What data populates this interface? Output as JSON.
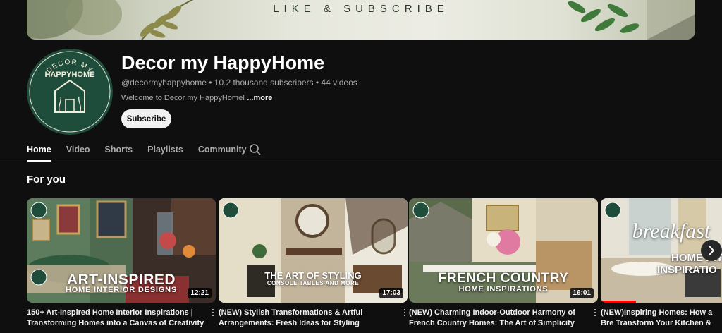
{
  "banner": {
    "text": "LIKE & SUBSCRIBE"
  },
  "channel": {
    "name": "Decor my HappyHome",
    "meta": "@decormyhappyhome • 10.2 thousand subscribers • 44 videos",
    "description": "Welcome to Decor my HappyHome!",
    "more_label": "...more",
    "subscribe_label": "Subscribe",
    "avatar_text_top": "DECOR MY",
    "avatar_text_mid": "HAPPYHOME",
    "accent_color": "#1f4d3c"
  },
  "tabs": [
    {
      "label": "Home",
      "active": true
    },
    {
      "label": "Video",
      "active": false
    },
    {
      "label": "Shorts",
      "active": false
    },
    {
      "label": "Playlists",
      "active": false
    },
    {
      "label": "Community",
      "active": false
    }
  ],
  "section": {
    "title": "For you"
  },
  "videos": [
    {
      "overlay_line1": "ART-INSPIRED",
      "overlay_line2": "HOME INTERIOR DESIGNS",
      "duration": "12:21",
      "title": "150+ Art-Inspired Home Interior Inspirations | Transforming Homes into a Canvas of Creativity"
    },
    {
      "overlay_line1": "THE ART OF STYLING",
      "overlay_line2": "CONSOLE TABLES AND MORE",
      "duration": "17:03",
      "title": "(NEW) Stylish Transformations & Artful Arrangements: Fresh Ideas for Styling Console..."
    },
    {
      "overlay_line1": "FRENCH COUNTRY",
      "overlay_line2": "HOME INSPIRATIONS",
      "duration": "16:01",
      "title": "(NEW) Charming Indoor-Outdoor Harmony of French Country Homes: The Art of Simplicity and Elegance"
    },
    {
      "overlay_line1": "breakfast",
      "overlay_line2": "HOME INT",
      "overlay_line3": "INSPIRATIO",
      "title": "(NEW)Inspiring Homes: How a Bre Transform Your Kitchen & Home |"
    }
  ]
}
